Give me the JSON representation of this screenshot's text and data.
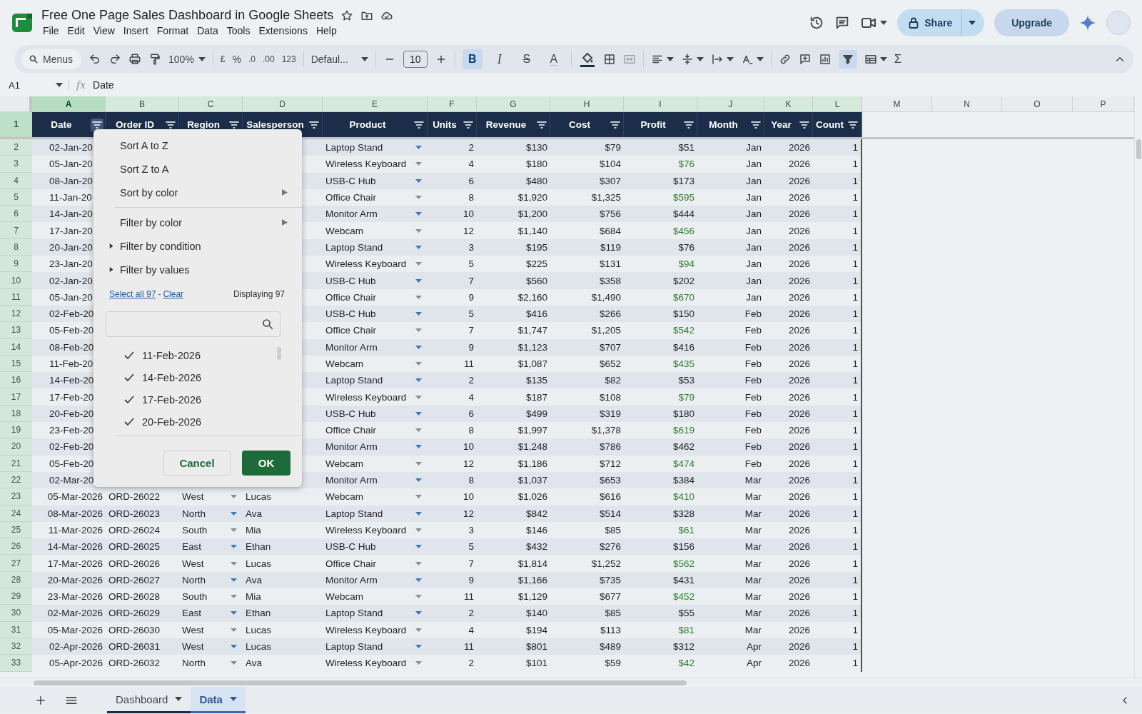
{
  "document": {
    "title": "Free One Page Sales Dashboard in Google Sheets",
    "menu": [
      "File",
      "Edit",
      "View",
      "Insert",
      "Format",
      "Data",
      "Tools",
      "Extensions",
      "Help"
    ]
  },
  "header_actions": {
    "share": "Share",
    "upgrade": "Upgrade"
  },
  "toolbar": {
    "search": "Menus",
    "zoom": "100%",
    "currency": "£",
    "percent": "%",
    "decimal_decrease": ".0",
    "decimal_increase": ".00",
    "number_format": "123",
    "font": "Defaul...",
    "font_size": "10",
    "sum": "Σ",
    "filter_on": true,
    "format_buttons": [
      {
        "label": "B",
        "kind": "bold",
        "selected": true
      },
      {
        "label": "I",
        "kind": "italic",
        "selected": false
      },
      {
        "label": "S",
        "kind": "strike",
        "selected": false
      },
      {
        "label": "A",
        "kind": "color",
        "selected": false
      }
    ]
  },
  "formula_bar": {
    "cell": "A1",
    "fx": "fx",
    "value": "Date"
  },
  "columns": [
    {
      "letter": "A",
      "selected": true
    },
    {
      "letter": "B",
      "selected": false
    },
    {
      "letter": "C",
      "selected": false
    },
    {
      "letter": "D",
      "selected": false
    },
    {
      "letter": "E",
      "selected": false
    },
    {
      "letter": "F",
      "selected": false
    },
    {
      "letter": "G",
      "selected": false
    },
    {
      "letter": "H",
      "selected": false
    },
    {
      "letter": "I",
      "selected": false
    },
    {
      "letter": "J",
      "selected": false
    },
    {
      "letter": "K",
      "selected": false
    },
    {
      "letter": "L",
      "selected": false
    },
    {
      "letter": "M",
      "selected": false
    },
    {
      "letter": "N",
      "selected": false
    },
    {
      "letter": "O",
      "selected": false
    },
    {
      "letter": "P",
      "selected": false
    }
  ],
  "header_row": {
    "n": "1",
    "cells": [
      {
        "label": "Date",
        "filter_open": true
      },
      {
        "label": "Order ID",
        "filter_open": false
      },
      {
        "label": "Region",
        "filter_open": false
      },
      {
        "label": "Salesperson",
        "filter_open": false
      },
      {
        "label": "Product",
        "filter_open": false
      },
      {
        "label": "Units",
        "filter_open": false
      },
      {
        "label": "Revenue",
        "filter_open": false
      },
      {
        "label": "Cost",
        "filter_open": false
      },
      {
        "label": "Profit",
        "filter_open": false
      },
      {
        "label": "Month",
        "filter_open": false
      },
      {
        "label": "Year",
        "filter_open": false
      },
      {
        "label": "Count",
        "filter_open": false
      }
    ]
  },
  "rows": [
    {
      "n": "2",
      "date": "02-Jan-20",
      "product": "Laptop Stand",
      "units": "2",
      "revenue": "$130",
      "cost": "$79",
      "profit": "$51",
      "profit_highlight": false,
      "month": "Jan",
      "year": "2026",
      "count": "1"
    },
    {
      "n": "3",
      "date": "05-Jan-20",
      "product": "Wireless Keyboard",
      "units": "4",
      "revenue": "$180",
      "cost": "$104",
      "profit": "$76",
      "profit_highlight": true,
      "month": "Jan",
      "year": "2026",
      "count": "1"
    },
    {
      "n": "4",
      "date": "08-Jan-20",
      "product": "USB-C Hub",
      "units": "6",
      "revenue": "$480",
      "cost": "$307",
      "profit": "$173",
      "profit_highlight": false,
      "month": "Jan",
      "year": "2026",
      "count": "1"
    },
    {
      "n": "5",
      "date": "11-Jan-20",
      "product": "Office Chair",
      "units": "8",
      "revenue": "$1,920",
      "cost": "$1,325",
      "profit": "$595",
      "profit_highlight": true,
      "month": "Jan",
      "year": "2026",
      "count": "1"
    },
    {
      "n": "6",
      "date": "14-Jan-20",
      "product": "Monitor Arm",
      "units": "10",
      "revenue": "$1,200",
      "cost": "$756",
      "profit": "$444",
      "profit_highlight": false,
      "month": "Jan",
      "year": "2026",
      "count": "1"
    },
    {
      "n": "7",
      "date": "17-Jan-20",
      "product": "Webcam",
      "units": "12",
      "revenue": "$1,140",
      "cost": "$684",
      "profit": "$456",
      "profit_highlight": true,
      "month": "Jan",
      "year": "2026",
      "count": "1"
    },
    {
      "n": "8",
      "date": "20-Jan-20",
      "product": "Laptop Stand",
      "units": "3",
      "revenue": "$195",
      "cost": "$119",
      "profit": "$76",
      "profit_highlight": false,
      "month": "Jan",
      "year": "2026",
      "count": "1"
    },
    {
      "n": "9",
      "date": "23-Jan-20",
      "product": "Wireless Keyboard",
      "units": "5",
      "revenue": "$225",
      "cost": "$131",
      "profit": "$94",
      "profit_highlight": true,
      "month": "Jan",
      "year": "2026",
      "count": "1"
    },
    {
      "n": "10",
      "date": "02-Jan-20",
      "product": "USB-C Hub",
      "units": "7",
      "revenue": "$560",
      "cost": "$358",
      "profit": "$202",
      "profit_highlight": false,
      "month": "Jan",
      "year": "2026",
      "count": "1"
    },
    {
      "n": "11",
      "date": "05-Jan-20",
      "product": "Office Chair",
      "units": "9",
      "revenue": "$2,160",
      "cost": "$1,490",
      "profit": "$670",
      "profit_highlight": true,
      "month": "Jan",
      "year": "2026",
      "count": "1"
    },
    {
      "n": "12",
      "date": "02-Feb-20",
      "product": "USB-C Hub",
      "units": "5",
      "revenue": "$416",
      "cost": "$266",
      "profit": "$150",
      "profit_highlight": false,
      "month": "Feb",
      "year": "2026",
      "count": "1"
    },
    {
      "n": "13",
      "date": "05-Feb-20",
      "product": "Office Chair",
      "units": "7",
      "revenue": "$1,747",
      "cost": "$1,205",
      "profit": "$542",
      "profit_highlight": true,
      "month": "Feb",
      "year": "2026",
      "count": "1"
    },
    {
      "n": "14",
      "date": "08-Feb-20",
      "product": "Monitor Arm",
      "units": "9",
      "revenue": "$1,123",
      "cost": "$707",
      "profit": "$416",
      "profit_highlight": false,
      "month": "Feb",
      "year": "2026",
      "count": "1"
    },
    {
      "n": "15",
      "date": "11-Feb-20",
      "product": "Webcam",
      "units": "11",
      "revenue": "$1,087",
      "cost": "$652",
      "profit": "$435",
      "profit_highlight": true,
      "month": "Feb",
      "year": "2026",
      "count": "1"
    },
    {
      "n": "16",
      "date": "14-Feb-20",
      "product": "Laptop Stand",
      "units": "2",
      "revenue": "$135",
      "cost": "$82",
      "profit": "$53",
      "profit_highlight": false,
      "month": "Feb",
      "year": "2026",
      "count": "1"
    },
    {
      "n": "17",
      "date": "17-Feb-20",
      "product": "Wireless Keyboard",
      "units": "4",
      "revenue": "$187",
      "cost": "$108",
      "profit": "$79",
      "profit_highlight": true,
      "month": "Feb",
      "year": "2026",
      "count": "1"
    },
    {
      "n": "18",
      "date": "20-Feb-20",
      "product": "USB-C Hub",
      "units": "6",
      "revenue": "$499",
      "cost": "$319",
      "profit": "$180",
      "profit_highlight": false,
      "month": "Feb",
      "year": "2026",
      "count": "1"
    },
    {
      "n": "19",
      "date": "23-Feb-20",
      "product": "Office Chair",
      "units": "8",
      "revenue": "$1,997",
      "cost": "$1,378",
      "profit": "$619",
      "profit_highlight": true,
      "month": "Feb",
      "year": "2026",
      "count": "1"
    },
    {
      "n": "20",
      "date": "02-Feb-20",
      "product": "Monitor Arm",
      "units": "10",
      "revenue": "$1,248",
      "cost": "$786",
      "profit": "$462",
      "profit_highlight": false,
      "month": "Feb",
      "year": "2026",
      "count": "1"
    },
    {
      "n": "21",
      "date": "05-Feb-20",
      "product": "Webcam",
      "units": "12",
      "revenue": "$1,186",
      "cost": "$712",
      "profit": "$474",
      "profit_highlight": true,
      "month": "Feb",
      "year": "2026",
      "count": "1"
    },
    {
      "n": "22",
      "date": "02-Mar-20",
      "product": "Monitor Arm",
      "units": "8",
      "revenue": "$1,037",
      "cost": "$653",
      "profit": "$384",
      "profit_highlight": false,
      "month": "Mar",
      "year": "2026",
      "count": "1"
    },
    {
      "n": "23",
      "date": "05-Mar-2026",
      "order_id": "ORD-26022",
      "region": "West",
      "salesperson": "Lucas",
      "product": "Webcam",
      "units": "10",
      "revenue": "$1,026",
      "cost": "$616",
      "profit": "$410",
      "profit_highlight": true,
      "month": "Mar",
      "year": "2026",
      "count": "1"
    },
    {
      "n": "24",
      "date": "08-Mar-2026",
      "order_id": "ORD-26023",
      "region": "North",
      "salesperson": "Ava",
      "product": "Laptop Stand",
      "units": "12",
      "revenue": "$842",
      "cost": "$514",
      "profit": "$328",
      "profit_highlight": false,
      "month": "Mar",
      "year": "2026",
      "count": "1"
    },
    {
      "n": "25",
      "date": "11-Mar-2026",
      "order_id": "ORD-26024",
      "region": "South",
      "salesperson": "Mia",
      "product": "Wireless Keyboard",
      "units": "3",
      "revenue": "$146",
      "cost": "$85",
      "profit": "$61",
      "profit_highlight": true,
      "month": "Mar",
      "year": "2026",
      "count": "1"
    },
    {
      "n": "26",
      "date": "14-Mar-2026",
      "order_id": "ORD-26025",
      "region": "East",
      "salesperson": "Ethan",
      "product": "USB-C Hub",
      "units": "5",
      "revenue": "$432",
      "cost": "$276",
      "profit": "$156",
      "profit_highlight": false,
      "month": "Mar",
      "year": "2026",
      "count": "1"
    },
    {
      "n": "27",
      "date": "17-Mar-2026",
      "order_id": "ORD-26026",
      "region": "West",
      "salesperson": "Lucas",
      "product": "Office Chair",
      "units": "7",
      "revenue": "$1,814",
      "cost": "$1,252",
      "profit": "$562",
      "profit_highlight": true,
      "month": "Mar",
      "year": "2026",
      "count": "1"
    },
    {
      "n": "28",
      "date": "20-Mar-2026",
      "order_id": "ORD-26027",
      "region": "North",
      "salesperson": "Ava",
      "product": "Monitor Arm",
      "units": "9",
      "revenue": "$1,166",
      "cost": "$735",
      "profit": "$431",
      "profit_highlight": false,
      "month": "Mar",
      "year": "2026",
      "count": "1"
    },
    {
      "n": "29",
      "date": "23-Mar-2026",
      "order_id": "ORD-26028",
      "region": "South",
      "salesperson": "Mia",
      "product": "Webcam",
      "units": "11",
      "revenue": "$1,129",
      "cost": "$677",
      "profit": "$452",
      "profit_highlight": true,
      "month": "Mar",
      "year": "2026",
      "count": "1"
    },
    {
      "n": "30",
      "date": "02-Mar-2026",
      "order_id": "ORD-26029",
      "region": "East",
      "salesperson": "Ethan",
      "product": "Laptop Stand",
      "units": "2",
      "revenue": "$140",
      "cost": "$85",
      "profit": "$55",
      "profit_highlight": false,
      "month": "Mar",
      "year": "2026",
      "count": "1"
    },
    {
      "n": "31",
      "date": "05-Mar-2026",
      "order_id": "ORD-26030",
      "region": "West",
      "salesperson": "Lucas",
      "product": "Wireless Keyboard",
      "units": "4",
      "revenue": "$194",
      "cost": "$113",
      "profit": "$81",
      "profit_highlight": true,
      "month": "Mar",
      "year": "2026",
      "count": "1"
    },
    {
      "n": "32",
      "date": "02-Apr-2026",
      "order_id": "ORD-26031",
      "region": "West",
      "salesperson": "Lucas",
      "product": "Laptop Stand",
      "units": "11",
      "revenue": "$801",
      "cost": "$489",
      "profit": "$312",
      "profit_highlight": false,
      "month": "Apr",
      "year": "2026",
      "count": "1"
    },
    {
      "n": "33",
      "date": "05-Apr-2026",
      "order_id": "ORD-26032",
      "region": "North",
      "salesperson": "Ava",
      "product": "Wireless Keyboard",
      "units": "2",
      "revenue": "$101",
      "cost": "$59",
      "profit": "$42",
      "profit_highlight": true,
      "month": "Apr",
      "year": "2026",
      "count": "1"
    }
  ],
  "filter_menu": {
    "sort_items": [
      {
        "label": "Sort A to Z",
        "kind": "plain"
      },
      {
        "label": "Sort Z to A",
        "kind": "plain"
      },
      {
        "label": "Sort by color",
        "kind": "submenu"
      }
    ],
    "filter_items": [
      {
        "label": "Filter by color",
        "kind": "submenu"
      },
      {
        "label": "Filter by condition",
        "kind": "section",
        "expanded": false
      },
      {
        "label": "Filter by values",
        "kind": "section",
        "expanded": false
      }
    ],
    "select_all": "Select all 97",
    "separator": "-",
    "clear": "Clear",
    "displaying": "Displaying 97",
    "values": [
      {
        "label": "11-Feb-2026",
        "checked": true
      },
      {
        "label": "14-Feb-2026",
        "checked": true
      },
      {
        "label": "17-Feb-2026",
        "checked": true
      },
      {
        "label": "20-Feb-2026",
        "checked": true
      }
    ],
    "cancel": "Cancel",
    "ok": "OK"
  },
  "sheet_tabs": [
    {
      "label": "Dashboard",
      "selected": false
    },
    {
      "label": "Data",
      "selected": true
    }
  ]
}
